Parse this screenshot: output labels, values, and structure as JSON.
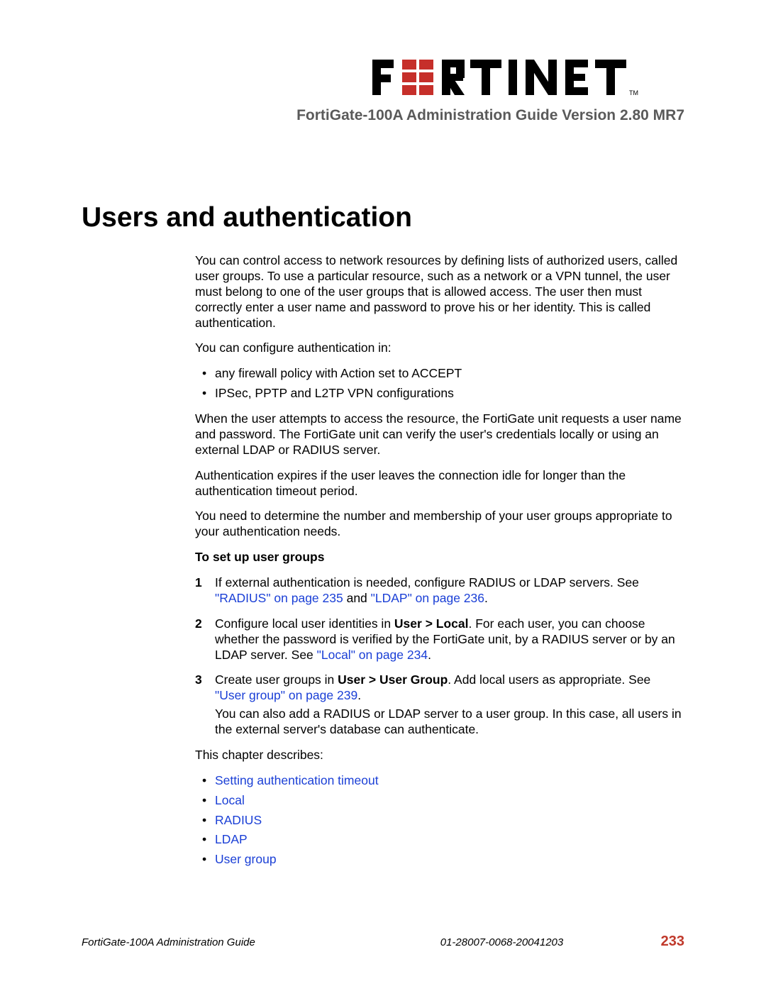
{
  "header": {
    "subtitle": "FortiGate-100A Administration Guide Version 2.80 MR7"
  },
  "chapter": {
    "title": "Users and authentication"
  },
  "body": {
    "p1": "You can control access to network resources by defining lists of authorized users, called user groups. To use a particular resource, such as a network or a VPN tunnel, the user must belong to one of the user groups that is allowed access. The user then must correctly enter a user name and password to prove his or her identity. This is called authentication.",
    "p2": "You can configure authentication in:",
    "bullets1": [
      "any firewall policy with Action set to ACCEPT",
      "IPSec, PPTP and L2TP VPN configurations"
    ],
    "p3": "When the user attempts to access the resource, the FortiGate unit requests a user name and password. The FortiGate unit can verify the user's credentials locally or using an external LDAP or RADIUS server.",
    "p4": "Authentication expires if the user leaves the connection idle for longer than the authentication timeout period.",
    "p5": "You need to determine the number and membership of your user groups appropriate to your authentication needs.",
    "h_setup": "To set up user groups",
    "steps": {
      "s1_a": "If external authentication is needed, configure RADIUS or LDAP servers. See ",
      "s1_link1": "\"RADIUS\" on page 235",
      "s1_mid": " and ",
      "s1_link2": "\"LDAP\" on page 236",
      "s1_end": ".",
      "s2_a": "Configure local user identities in ",
      "s2_bold": "User > Local",
      "s2_b": ". For each user, you can choose whether the password is verified by the FortiGate unit, by a RADIUS server or by an LDAP server. See ",
      "s2_link": "\"Local\" on page 234",
      "s2_end": ".",
      "s3_a": "Create user groups in ",
      "s3_bold": "User > User Group",
      "s3_b": ". Add local users as appropriate. See ",
      "s3_link": "\"User group\" on page 239",
      "s3_end": ".",
      "s3_p2": "You can also add a RADIUS or LDAP server to a user group. In this case, all users in the external server's database can authenticate."
    },
    "p6": "This chapter describes:",
    "chapter_links": [
      "Setting authentication timeout",
      "Local",
      "RADIUS",
      "LDAP",
      "User group"
    ]
  },
  "footer": {
    "left": "FortiGate-100A Administration Guide",
    "mid": "01-28007-0068-20041203",
    "page": "233"
  }
}
